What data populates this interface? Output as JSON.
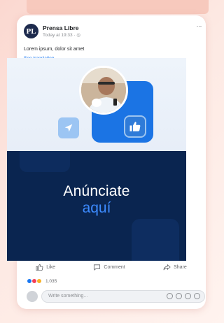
{
  "post": {
    "page_name": "Prensa Libre",
    "avatar_text": "PL",
    "time": "Today at 19:33 · ",
    "more": "···",
    "text": "Lorem ipsum, dolor sit amet",
    "see_translation": "See translation"
  },
  "ad": {
    "line1": "Anúnciate",
    "line2": "aquí"
  },
  "actions": {
    "like": "Like",
    "comment": "Comment",
    "share": "Share"
  },
  "reactions": {
    "count": "1.035",
    "icons": [
      "like-icon",
      "love-icon",
      "haha-icon"
    ]
  },
  "comment_box": {
    "placeholder": "Write something..."
  },
  "colors": {
    "fb_blue": "#1877f2",
    "ad_navy": "#0a2550",
    "ad_accent": "#3d8bff"
  }
}
